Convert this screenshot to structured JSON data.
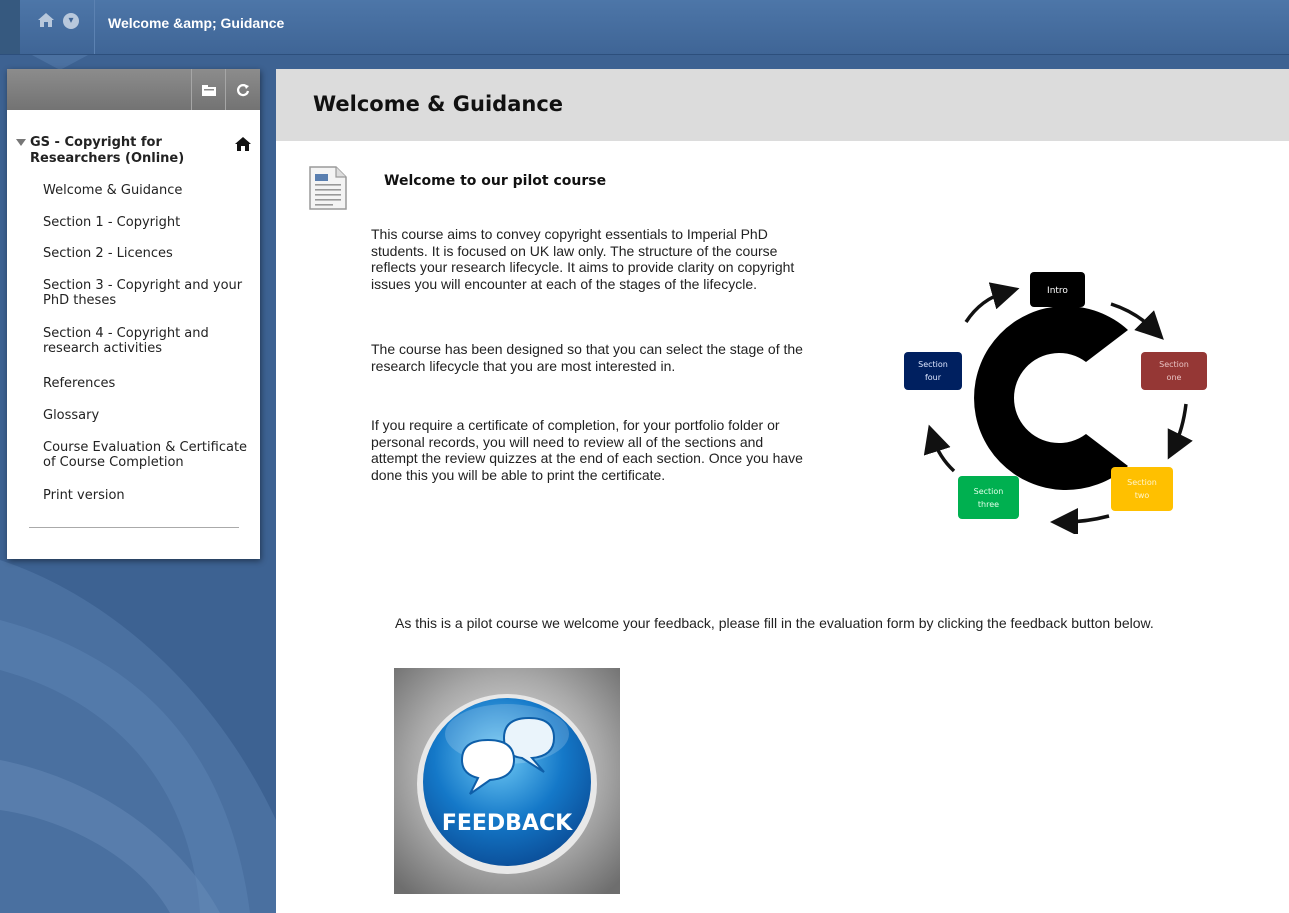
{
  "topbar": {
    "breadcrumb": "Welcome &amp; Guidance",
    "home_icon": "home-icon",
    "menu_icon": "chevron-down-icon"
  },
  "course_menu": {
    "toolbar_icons": [
      "folder-view-icon",
      "refresh-icon"
    ],
    "course_title": "GS - Copyright for Researchers (Online)",
    "items": [
      {
        "label": "Welcome & Guidance"
      },
      {
        "label": "Section 1 - Copyright"
      },
      {
        "label": "Section 2 - Licences"
      },
      {
        "label": "Section 3 - Copyright and your PhD theses"
      },
      {
        "label": "Section 4 - Copyright and research activities"
      },
      {
        "label": "References"
      },
      {
        "label": "Glossary"
      },
      {
        "label": "Course Evaluation & Certificate of Course Completion"
      },
      {
        "label": "Print version"
      }
    ]
  },
  "content": {
    "page_title": "Welcome & Guidance",
    "item_title": "Welcome to our pilot course",
    "paragraphs": [
      "This course aims to convey copyright essentials to Imperial PhD students. It is focused on UK law only. The structure of the course reflects your research lifecycle. It aims to provide clarity on copyright issues you will encounter at each of the stages of the lifecycle.",
      "The course has been designed so that you can select the stage of the research lifecycle that you are most interested in.",
      "If you require a certificate of completion, for your portfolio folder or personal records, you will need to review all of the sections and attempt the review quizzes at the end of each section. Once you have done this you will be able to print the certificate."
    ],
    "lifecycle": {
      "intro": "Intro",
      "one": [
        "Section",
        "one"
      ],
      "two": [
        "Section",
        "two"
      ],
      "three": [
        "Section",
        "three"
      ],
      "four": [
        "Section",
        "four"
      ],
      "colors": {
        "intro": "#000000",
        "one": "#953735",
        "two": "#ffc000",
        "three": "#00b050",
        "four": "#002060"
      }
    },
    "feedback_text": "As this is a pilot course we welcome your feedback, please fill in the evaluation form by clicking the feedback button below.",
    "feedback_label": "FEEDBACK"
  }
}
